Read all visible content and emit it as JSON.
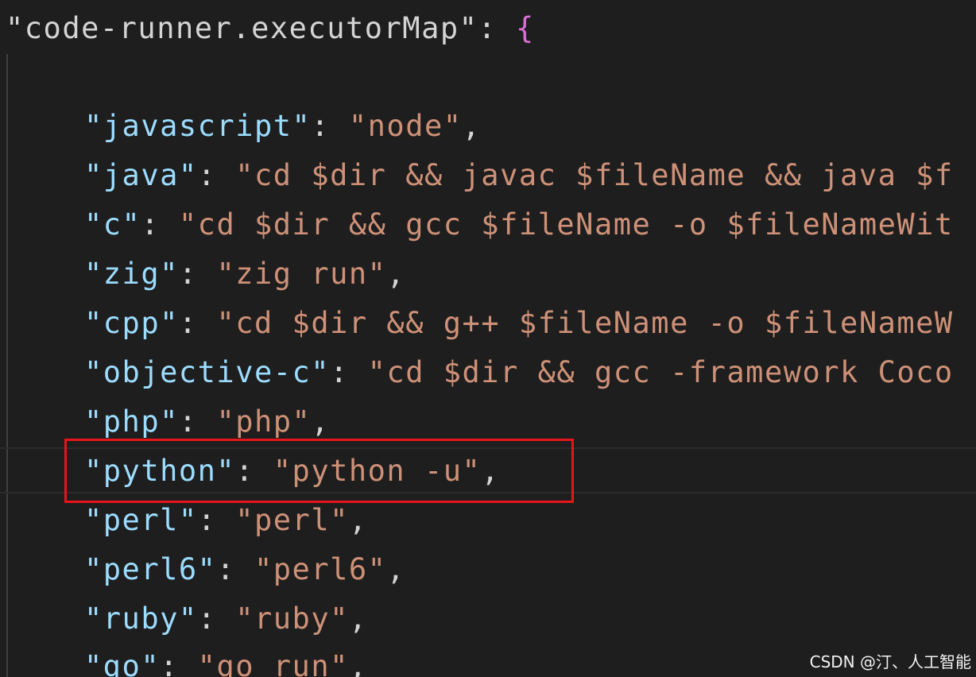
{
  "editor": {
    "header": {
      "key": "\"code-runner.executorMap\"",
      "colon": ": ",
      "brace": "{"
    },
    "lines": [
      {
        "key": "\"javascript\"",
        "sep": ": ",
        "value": "\"node\"",
        "end": ","
      },
      {
        "key": "\"java\"",
        "sep": ": ",
        "value": "\"cd $dir && javac $fileName && java $f",
        "end": ""
      },
      {
        "key": "\"c\"",
        "sep": ": ",
        "value": "\"cd $dir && gcc $fileName -o $fileNameWit",
        "end": ""
      },
      {
        "key": "\"zig\"",
        "sep": ": ",
        "value": "\"zig run\"",
        "end": ","
      },
      {
        "key": "\"cpp\"",
        "sep": ": ",
        "value": "\"cd $dir && g++ $fileName -o $fileNameW",
        "end": ""
      },
      {
        "key": "\"objective-c\"",
        "sep": ": ",
        "value": "\"cd $dir && gcc -framework Coco",
        "end": ""
      },
      {
        "key": "\"php\"",
        "sep": ": ",
        "value": "\"php\"",
        "end": ","
      },
      {
        "key": "\"python\"",
        "sep": ": ",
        "value": "\"python -u\"",
        "end": ","
      },
      {
        "key": "\"perl\"",
        "sep": ": ",
        "value": "\"perl\"",
        "end": ","
      },
      {
        "key": "\"perl6\"",
        "sep": ": ",
        "value": "\"perl6\"",
        "end": ","
      },
      {
        "key": "\"ruby\"",
        "sep": ": ",
        "value": "\"ruby\"",
        "end": ","
      },
      {
        "key": "\"go\"",
        "sep": ": ",
        "value": "\"go run\"",
        "end": ","
      }
    ]
  },
  "colors": {
    "background": "#1e1e1e",
    "key": "#9cdcfe",
    "string": "#ce9178",
    "punctuation": "#d4d4d4",
    "brace": "#da70d6",
    "highlight_box": "#e8141c"
  },
  "watermark": "CSDN @汀、人工智能"
}
